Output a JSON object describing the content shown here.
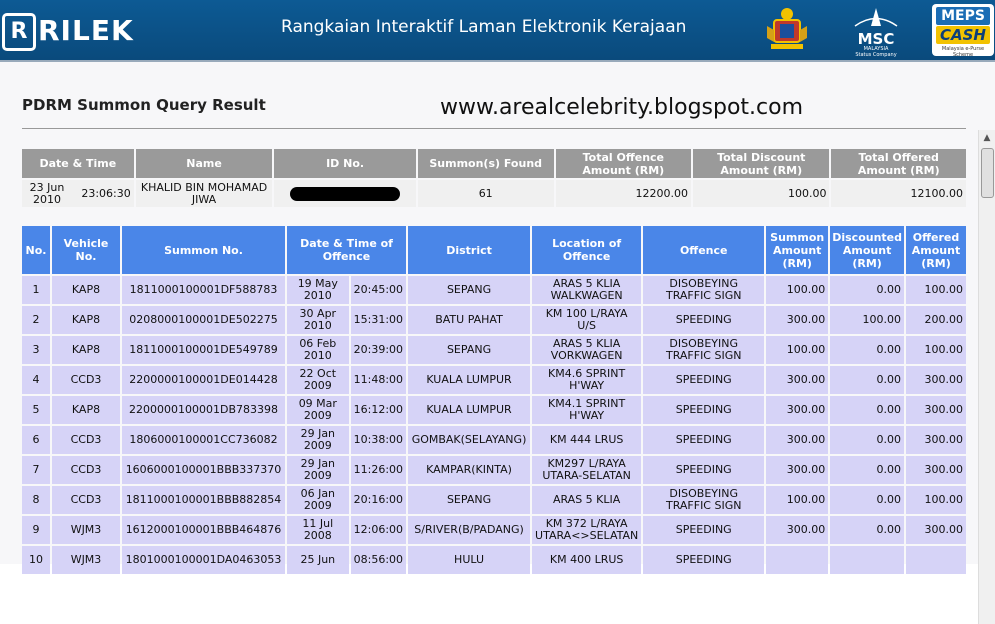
{
  "header": {
    "logo_letter": "R",
    "logo_text": "RILEK",
    "title": "Rangkaian Interaktif Laman Elektronik Kerajaan",
    "msc_label": "MSC",
    "msc_sub": "MALAYSIA",
    "msc_sub2": "Status Company",
    "meps_label": "MEPS",
    "meps_cash": "CASH",
    "meps_sub": "Malaysia e-Purse Scheme"
  },
  "page": {
    "title": "PDRM Summon Query Result",
    "watermark": "www.arealcelebrity.blogspot.com"
  },
  "summary": {
    "headers": [
      "Date & Time",
      "Name",
      "ID No.",
      "Summon(s) Found",
      "Total Offence Amount (RM)",
      "Total Discount Amount (RM)",
      "Total Offered Amount (RM)"
    ],
    "date": "23 Jun 2010",
    "time": "23:06:30",
    "name": "KHALID BIN MOHAMAD JIWA",
    "found": "61",
    "total_offence": "12200.00",
    "total_discount": "100.00",
    "total_offered": "12100.00"
  },
  "table": {
    "headers": [
      "No.",
      "Vehicle No.",
      "Summon No.",
      "Date & Time of Offence",
      "District",
      "Location of Offence",
      "Offence",
      "Summon Amount (RM)",
      "Discounted Amount (RM)",
      "Offered Amount (RM)"
    ],
    "rows": [
      [
        "1",
        "KAP8",
        "1811000100001DF588783",
        "19 May 2010",
        "20:45:00",
        "SEPANG",
        "ARAS 5 KLIA WALKWAGEN",
        "DISOBEYING TRAFFIC SIGN",
        "100.00",
        "0.00",
        "100.00"
      ],
      [
        "2",
        "KAP8",
        "0208000100001DE502275",
        "30 Apr 2010",
        "15:31:00",
        "BATU PAHAT",
        "KM 100 L/RAYA U/S",
        "SPEEDING",
        "300.00",
        "100.00",
        "200.00"
      ],
      [
        "3",
        "KAP8",
        "1811000100001DE549789",
        "06 Feb 2010",
        "20:39:00",
        "SEPANG",
        "ARAS 5 KLIA VORKWAGEN",
        "DISOBEYING TRAFFIC SIGN",
        "100.00",
        "0.00",
        "100.00"
      ],
      [
        "4",
        "CCD3",
        "2200000100001DE014428",
        "22 Oct 2009",
        "11:48:00",
        "KUALA LUMPUR",
        "KM4.6 SPRINT H'WAY",
        "SPEEDING",
        "300.00",
        "0.00",
        "300.00"
      ],
      [
        "5",
        "KAP8",
        "2200000100001DB783398",
        "09 Mar 2009",
        "16:12:00",
        "KUALA LUMPUR",
        "KM4.1 SPRINT H'WAY",
        "SPEEDING",
        "300.00",
        "0.00",
        "300.00"
      ],
      [
        "6",
        "CCD3",
        "1806000100001CC736082",
        "29 Jan 2009",
        "10:38:00",
        "GOMBAK(SELAYANG)",
        "KM 444 LRUS",
        "SPEEDING",
        "300.00",
        "0.00",
        "300.00"
      ],
      [
        "7",
        "CCD3",
        "1606000100001BBB337370",
        "29 Jan 2009",
        "11:26:00",
        "KAMPAR(KINTA)",
        "KM297 L/RAYA UTARA-SELATAN",
        "SPEEDING",
        "300.00",
        "0.00",
        "300.00"
      ],
      [
        "8",
        "CCD3",
        "1811000100001BBB882854",
        "06 Jan 2009",
        "20:16:00",
        "SEPANG",
        "ARAS 5 KLIA",
        "DISOBEYING TRAFFIC SIGN",
        "100.00",
        "0.00",
        "100.00"
      ],
      [
        "9",
        "WJM3",
        "1612000100001BBB464876",
        "11 Jul 2008",
        "12:06:00",
        "S/RIVER(B/PADANG)",
        "KM 372 L/RAYA UTARA<>SELATAN",
        "SPEEDING",
        "300.00",
        "0.00",
        "300.00"
      ],
      [
        "10",
        "WJM3",
        "1801000100001DA0463053",
        "25 Jun",
        "08:56:00",
        "HULU",
        "KM 400 LRUS",
        "SPEEDING",
        "",
        "",
        ""
      ]
    ]
  },
  "colors": {
    "header_bg": "#0d5a94",
    "summary_header": "#9a9a9a",
    "table_header": "#4a86e8",
    "table_cell": "#d6d3f7"
  }
}
